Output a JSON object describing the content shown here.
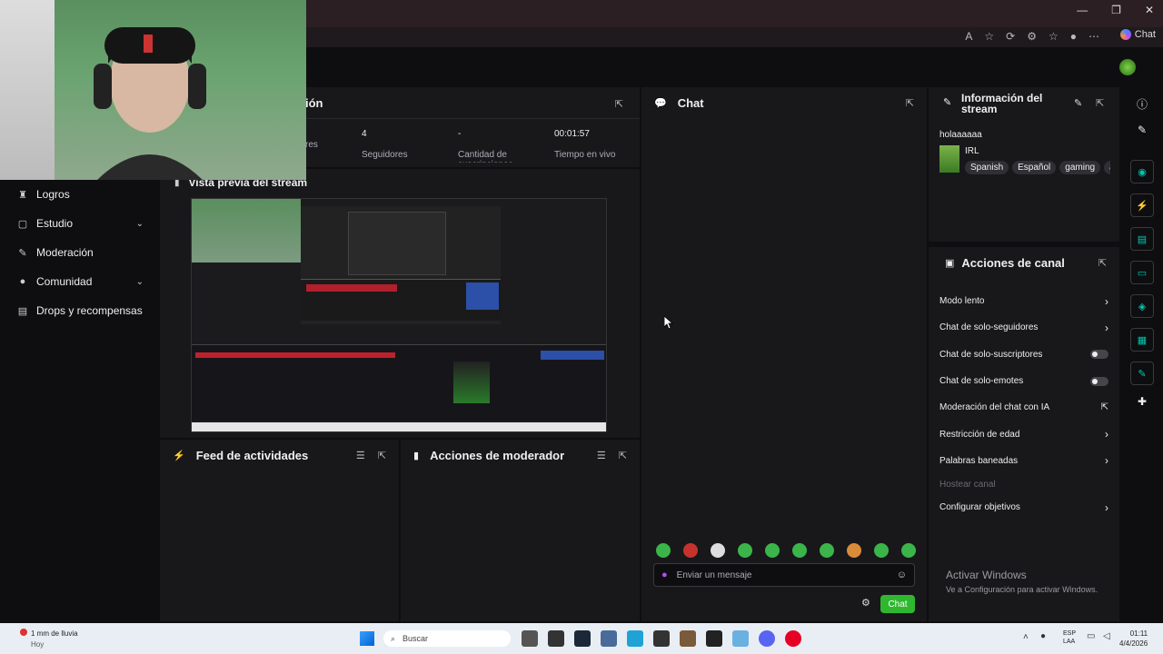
{
  "browser": {
    "window_controls": [
      "—",
      "❐",
      "✕"
    ],
    "addr_icons": [
      "A",
      "☆",
      "⟳",
      "⚙",
      "☆",
      "●",
      "⋯"
    ],
    "copilot_label": "Chat"
  },
  "sidebar": {
    "items": [
      {
        "label": "Logros",
        "icon": "trophy-icon",
        "chevron": false
      },
      {
        "label": "Estudio",
        "icon": "studio-icon",
        "chevron": true
      },
      {
        "label": "Moderación",
        "icon": "wrench-icon",
        "chevron": false
      },
      {
        "label": "Comunidad",
        "icon": "person-icon",
        "chevron": true
      },
      {
        "label": "Drops y recompensas",
        "icon": "gift-icon",
        "chevron": false
      }
    ]
  },
  "stats": {
    "title_fragment": "ión",
    "items": [
      {
        "value": "",
        "label": "res"
      },
      {
        "value": "4",
        "label": "Seguidores"
      },
      {
        "value": "-",
        "label": "Cantidad de suscripciones"
      },
      {
        "value": "00:01:57",
        "label": "Tiempo en vivo"
      }
    ]
  },
  "preview": {
    "title": "Vista previa del stream"
  },
  "feed": {
    "title": "Feed de actividades"
  },
  "mod_actions": {
    "title": "Acciones de moderador"
  },
  "chat": {
    "title": "Chat",
    "input_placeholder": "Enviar un mensaje",
    "send_label": "Chat"
  },
  "stream_info": {
    "title": "Información del stream",
    "stream_title": "holaaaaaa",
    "category": "IRL",
    "tags": [
      "Spanish",
      "Español",
      "gaming",
      "a"
    ]
  },
  "channel_actions": {
    "title": "Acciones de canal",
    "items": [
      {
        "label": "Modo lento",
        "control": "chevron"
      },
      {
        "label": "Chat de solo-seguidores",
        "control": "chevron"
      },
      {
        "label": "Chat de solo-suscriptores",
        "control": "toggle"
      },
      {
        "label": "Chat de solo-emotes",
        "control": "toggle"
      },
      {
        "label": "Moderación del chat con IA",
        "control": "external"
      },
      {
        "label": "Restricción de edad",
        "control": "chevron"
      },
      {
        "label": "Palabras baneadas",
        "control": "chevron"
      },
      {
        "label": "Hostear canal",
        "control": "none",
        "disabled": true
      },
      {
        "label": "Configurar objetivos",
        "control": "chevron"
      }
    ]
  },
  "watermark": {
    "line1": "Activar Windows",
    "line2": "Ve a Configuración para activar Windows."
  },
  "taskbar": {
    "weather": "1 mm de lluvia",
    "weather_sub": "Hoy",
    "search": "Buscar",
    "lang": "ESP",
    "lang_sub": "LAA",
    "time": "01:11",
    "date": "4/4/2026"
  },
  "colors": {
    "accent": "#00c8af",
    "send": "#2fb82f",
    "panel": "#18181b",
    "bg": "#0e0e10"
  }
}
